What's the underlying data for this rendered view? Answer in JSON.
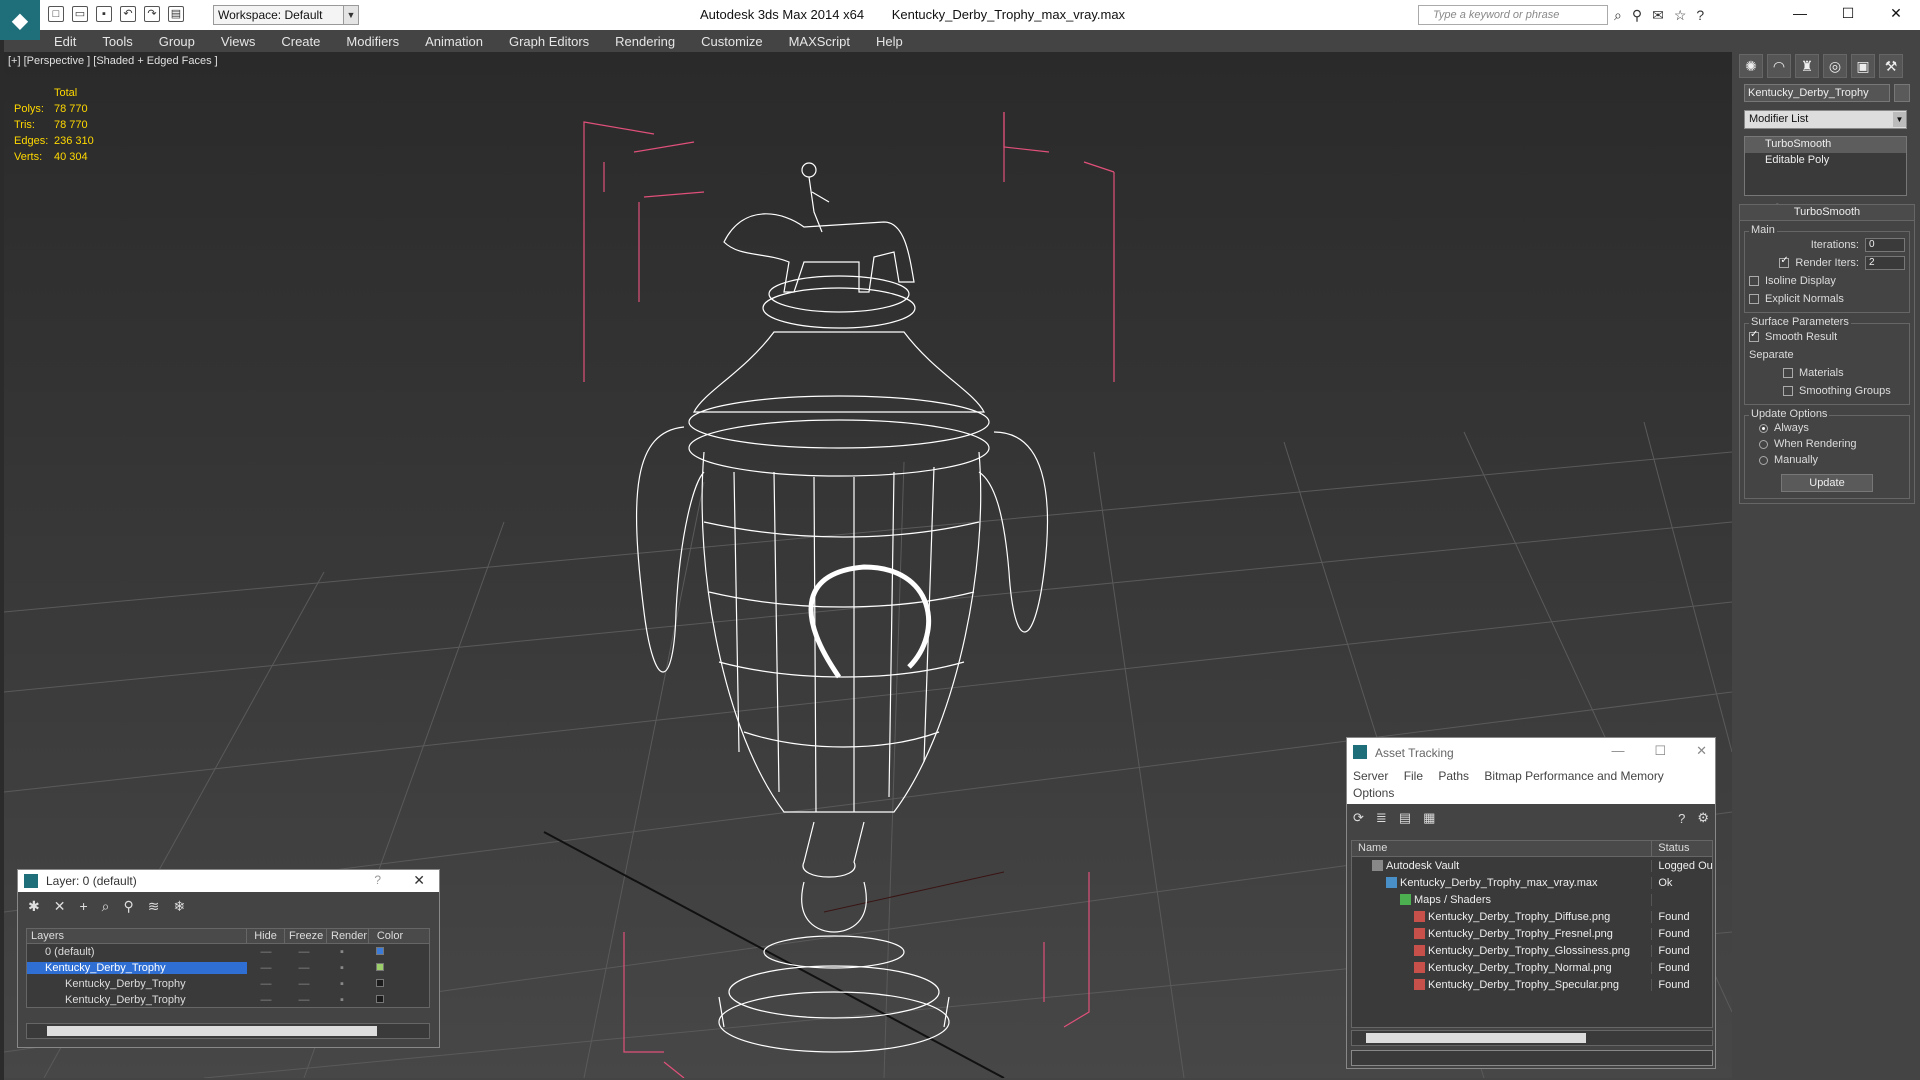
{
  "app": {
    "title": "Autodesk 3ds Max  2014 x64",
    "file": "Kentucky_Derby_Trophy_max_vray.max",
    "workspace": "Workspace: Default",
    "search_placeholder": "Type a keyword or phrase"
  },
  "menu": [
    "Edit",
    "Tools",
    "Group",
    "Views",
    "Create",
    "Modifiers",
    "Animation",
    "Graph Editors",
    "Rendering",
    "Customize",
    "MAXScript",
    "Help"
  ],
  "viewport": {
    "label": "[+] [Perspective ] [Shaded + Edged Faces ]",
    "stats": {
      "total_label": "Total",
      "rows": [
        {
          "label": "Polys:",
          "value": "78 770"
        },
        {
          "label": "Tris:",
          "value": "78 770"
        },
        {
          "label": "Edges:",
          "value": "236 310"
        },
        {
          "label": "Verts:",
          "value": "40 304"
        }
      ]
    }
  },
  "command_panel": {
    "object_name": "Kentucky_Derby_Trophy",
    "modifier_list": "Modifier List",
    "stack": [
      "TurboSmooth",
      "Editable Poly"
    ],
    "turbosmooth": {
      "title": "TurboSmooth",
      "main_label": "Main",
      "iterations_label": "Iterations:",
      "iterations": "0",
      "render_iters_label": "Render Iters:",
      "render_iters": "2",
      "isoline": "Isoline Display",
      "explicit": "Explicit Normals",
      "surface_label": "Surface Parameters",
      "smooth_result": "Smooth Result",
      "separate_label": "Separate",
      "materials": "Materials",
      "smoothing_groups": "Smoothing Groups",
      "update_label": "Update Options",
      "always": "Always",
      "when_rendering": "When Rendering",
      "manually": "Manually",
      "update_button": "Update"
    }
  },
  "layer_window": {
    "title": "Layer: 0 (default)",
    "columns": [
      "Layers",
      "Hide",
      "Freeze",
      "Render",
      "Color"
    ],
    "rows": [
      {
        "name": "0 (default)",
        "color": "#3d7bd8",
        "selected": false
      },
      {
        "name": "Kentucky_Derby_Trophy",
        "color": "#9ccf6a",
        "selected": true
      },
      {
        "name": "Kentucky_Derby_Trophy",
        "color": "#1c1c1c",
        "selected": false
      },
      {
        "name": "Kentucky_Derby_Trophy",
        "color": "#1c1c1c",
        "selected": false
      }
    ]
  },
  "asset_window": {
    "title": "Asset Tracking",
    "menu": [
      "Server",
      "File",
      "Paths",
      "Bitmap Performance and Memory",
      "Options"
    ],
    "columns": [
      "Name",
      "Status"
    ],
    "rows": [
      {
        "name": "Autodesk Vault",
        "status": "Logged Out",
        "indent": 1
      },
      {
        "name": "Kentucky_Derby_Trophy_max_vray.max",
        "status": "Ok",
        "indent": 2
      },
      {
        "name": "Maps / Shaders",
        "status": "",
        "indent": 3
      },
      {
        "name": "Kentucky_Derby_Trophy_Diffuse.png",
        "status": "Found",
        "indent": 4
      },
      {
        "name": "Kentucky_Derby_Trophy_Fresnel.png",
        "status": "Found",
        "indent": 4
      },
      {
        "name": "Kentucky_Derby_Trophy_Glossiness.png",
        "status": "Found",
        "indent": 4
      },
      {
        "name": "Kentucky_Derby_Trophy_Normal.png",
        "status": "Found",
        "indent": 4
      },
      {
        "name": "Kentucky_Derby_Trophy_Specular.png",
        "status": "Found",
        "indent": 4
      }
    ]
  }
}
